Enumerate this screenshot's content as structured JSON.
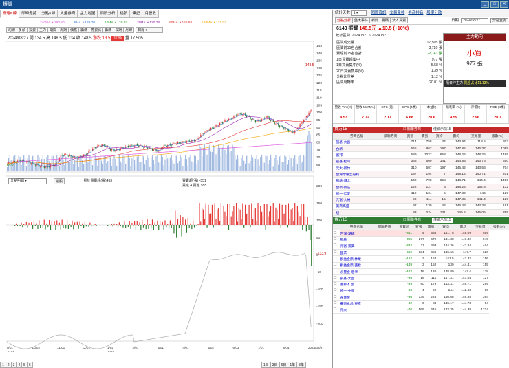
{
  "window": {
    "title": "振耀",
    "buttons": [
      "▁",
      "□",
      "✕"
    ]
  },
  "main_tabs": [
    "振耀K線",
    "即時走勢",
    "分點K線",
    "大量券商",
    "主力地圖",
    "個股分析",
    "檔股",
    "筆記",
    "月營收"
  ],
  "ma_bar": [
    {
      "label": "240MA ▲190.80",
      "color": "#e060e0"
    },
    {
      "label": "5MA ▲133.70",
      "color": "#3a7bd5"
    },
    {
      "label": "10MA ▲120.93",
      "color": "#2a9d2a"
    },
    {
      "label": "20MA ▲120.78",
      "color": "#9c27b0"
    },
    {
      "label": "60MA ▲125.88",
      "color": "#e53935"
    },
    {
      "label": "120MA ▲121.03",
      "color": "#f4a300"
    }
  ],
  "tool_buttons": [
    "均線",
    "多頭",
    "投資",
    "主力",
    "期間",
    "周期",
    "價格",
    "籌碼",
    "券資比",
    "籌碼",
    "長期",
    "月線"
  ],
  "period_select": "日線",
  "quote_line": {
    "date": "2024/08/27",
    "open": "開 134.5",
    "high": "高 148.5",
    "low": "低 134",
    "close": "收 148.5",
    "change": "漲跌 13.5",
    "pct": "10%",
    "vol": "量 17,505"
  },
  "price_axis": [
    "145",
    "140",
    "135",
    "130",
    "125",
    "120",
    "115",
    "110",
    "105",
    "100",
    "95",
    "90",
    "85",
    "80",
    "75",
    "70",
    "65"
  ],
  "vol_axis": [
    "200",
    "150",
    "100",
    "50",
    "0",
    "-50",
    "-100",
    "-150",
    "-200"
  ],
  "chart_labels": {
    "price_last": "148.5",
    "price_left": "65.2",
    "sub_select": "分點明細",
    "sub_btn": "檔股",
    "legend1": "一 累計買賣超(張)453",
    "legend2": "買賣超(張) -551",
    "legend3": "買進 4 賣進 555",
    "sub_last": "-133.9"
  },
  "x_dates": [
    "9/01\n2023",
    "10/02",
    "11/01",
    "12/01",
    "1/02\n2024",
    "2/01",
    "3/01",
    "4/01",
    "5/02",
    "6/03",
    "7/01",
    "8/01",
    "2024/08/27"
  ],
  "pager": [
    "1",
    "2",
    "3",
    "4",
    "5",
    "6"
  ],
  "range_btns": [
    "1日",
    "3日",
    "6日",
    "1年",
    "3年"
  ],
  "right_top": {
    "title": "統計天數",
    "days": "1",
    "tabs": [
      "國際資訊",
      "交易量排",
      "券商排名",
      "股權分散"
    ],
    "date_label": "日期",
    "date": "2024/08/27",
    "lookup": "分點查詢",
    "subtabs": [
      "分點分析",
      "盤大事件",
      "新聞",
      "籌碼",
      "法人買賣"
    ]
  },
  "stock_header": {
    "code": "6143 振耀",
    "price": "148.5元",
    "chg": "▲13.5 (+10%)"
  },
  "stats": {
    "range_label": "統計區間",
    "range": "20240827 ~ 20240827",
    "rows": [
      [
        "區間成交量",
        "17,505 張"
      ],
      [
        "區間前15名合計",
        "3,720 張"
      ],
      [
        "賣超前15名合計",
        "-2,743 張"
      ],
      [
        "1日買賣超集中",
        "977 張"
      ],
      [
        "1日買賣集中(%)",
        "5.58 %"
      ],
      [
        "20日買賣集中(%)",
        "1.39 %"
      ],
      [
        "分點比重差",
        "1.12 %"
      ],
      [
        "區間周轉率",
        "20.01 %"
      ]
    ]
  },
  "main_force": {
    "title": "主力動向",
    "verdict": "小買",
    "amount": "977 張",
    "note_label": "隔日沖主力",
    "note": "買超占比11.13%"
  },
  "metrics": [
    {
      "name": "營收 YoY(%)",
      "val": "4.53"
    },
    {
      "name": "營收 MoM(%)",
      "val": "7.72"
    },
    {
      "name": "EPS (元)",
      "val": "2.17"
    },
    {
      "name": "EPS (4季)",
      "val": "6.68"
    },
    {
      "name": "本益比",
      "val": "20.6"
    },
    {
      "name": "殖利率 (%)",
      "val": "4.59"
    },
    {
      "name": "淨值比",
      "val": "2.96"
    },
    {
      "name": "ROE (4季)",
      "val": "20.7"
    }
  ],
  "buy_section": {
    "title": "買方15",
    "filter": "關聯券商",
    "filter_sel": "僅顯示前15",
    "headers": [
      "",
      "券商名稱",
      "關聯券商",
      "買張",
      "賣張",
      "買均",
      "賣均",
      "交易量",
      "張數(%)"
    ],
    "rows": [
      [
        "",
        "凱基-大昌",
        "",
        "714",
        "758",
        "44",
        "143.94",
        "118.5",
        "802"
      ],
      [
        "",
        "台新",
        "",
        "665",
        "862",
        "197",
        "147.86",
        "146.37",
        "1059"
      ],
      [
        "",
        "富邦",
        "",
        "589",
        "1027",
        "658",
        "148.26",
        "148.26",
        "1485"
      ],
      [
        "",
        "凱基-松山",
        "",
        "368",
        "509",
        "141",
        "144.85",
        "143.76",
        "650"
      ],
      [
        "",
        "元大-新竹",
        "",
        "310",
        "507",
        "197",
        "145.42",
        "143.56",
        "704"
      ],
      [
        "",
        "台灣摩根士丹利",
        "",
        "187",
        "194",
        "7",
        "148.14",
        "140.71",
        "201"
      ],
      [
        "",
        "凱基-城北",
        "",
        "140",
        "798",
        "658",
        "143.71",
        "144.4",
        "1456"
      ],
      [
        "",
        "台新-新莊",
        "",
        "122",
        "127",
        "5",
        "148.24",
        "152.8",
        "132"
      ],
      [
        "",
        "統一-仁愛",
        "",
        "119",
        "124",
        "5",
        "147.82",
        "146",
        "129"
      ],
      [
        "",
        "元富-大裕",
        "",
        "99",
        "114",
        "15",
        "147.85",
        "141.4",
        "129"
      ],
      [
        "",
        "美商高盛",
        "",
        "97",
        "139",
        "42",
        "146.43",
        "144.38",
        "181"
      ],
      [
        "",
        "統一",
        "",
        "93",
        "224",
        "131",
        "145.6",
        "145.05",
        "355"
      ]
    ]
  },
  "sell_section": {
    "title": "賣方15",
    "filter": "關聯券商",
    "filter_sel": "僅顯示前15",
    "headers": [
      "",
      "券商名稱",
      "關聯券商",
      "買賣超",
      "買張",
      "賣張",
      "買均",
      "賣均",
      "交易量",
      "張數(%)"
    ],
    "rows": [
      [
        "台灣-湖錦",
        "",
        "-551",
        "4",
        "555",
        "141.75",
        "148.09",
        "559"
      ],
      [
        "凱基",
        "",
        "-395",
        "277",
        "672",
        "141.38",
        "147.32",
        "949"
      ],
      [
        "元富-景美",
        "",
        "-382",
        "11",
        "393",
        "144.36",
        "147.84",
        "404"
      ],
      [
        "國票",
        "",
        "-352",
        "134",
        "486",
        "146.66",
        "147.7",
        "620"
      ],
      [
        "群益金鼎-林榮",
        "",
        "-152",
        "2",
        "154",
        "141.5",
        "147.32",
        "156"
      ],
      [
        "群益金鼎-西松",
        "",
        "-149",
        "3",
        "152",
        "139",
        "144.41",
        "155"
      ],
      [
        "永豐金-忠孝",
        "",
        "-102",
        "18",
        "120",
        "148.89",
        "147.4",
        "138"
      ],
      [
        "凱基-大昌",
        "",
        "-95",
        "16",
        "111",
        "147.31",
        "147.04",
        "127"
      ],
      [
        "富邦-仁愛",
        "",
        "-89",
        "90",
        "179",
        "143.31",
        "146.71",
        "269"
      ],
      [
        "統一-中壢",
        "",
        "-86",
        "4",
        "92",
        "144",
        "142.63",
        "96"
      ],
      [
        "永豐金",
        "",
        "-86",
        "139",
        "225",
        "146.68",
        "146.85",
        "364"
      ],
      [
        "華南永昌-東京",
        "",
        "-82",
        "6",
        "88",
        "146.17",
        "144.73",
        "94"
      ],
      [
        "元大",
        "",
        "-76",
        "569",
        "645",
        "143.35",
        "144.38",
        "1214"
      ]
    ]
  }
}
